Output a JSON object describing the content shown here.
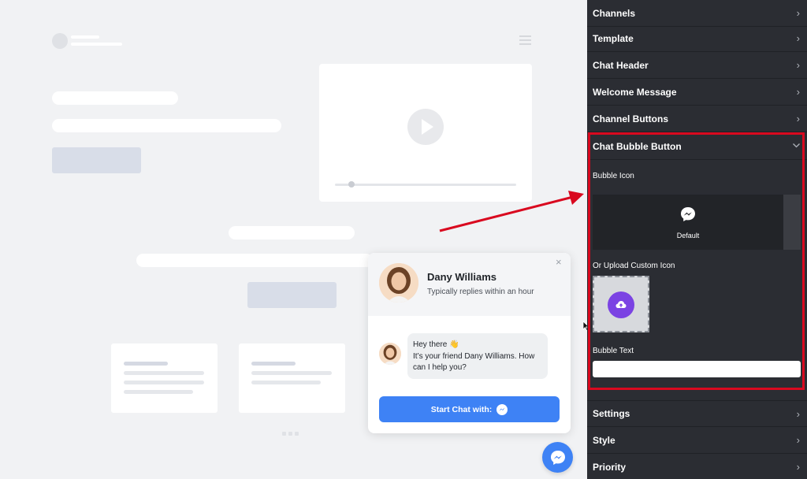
{
  "widget": {
    "name": "Dany Williams",
    "subtitle": "Typically replies within an hour",
    "close": "×",
    "message_line1": "Hey there 👋",
    "message_line2": "It’s your friend Dany Williams. How can I help you?",
    "start_label": "Start Chat with:"
  },
  "panel": {
    "rows_top": [
      "Channels",
      "Template",
      "Chat Header",
      "Welcome Message",
      "Channel Buttons"
    ],
    "section_title": "Chat Bubble Button",
    "bubble_icon_label": "Bubble Icon",
    "default_label": "Default",
    "upload_label": "Or Upload Custom Icon",
    "bubble_text_label": "Bubble Text",
    "bubble_text_value": "",
    "rows_bottom": [
      "Settings",
      "Style",
      "Priority"
    ]
  },
  "colors": {
    "accent": "#3e82f5",
    "highlight": "#d9091f",
    "panel_bg": "#2b2d33",
    "upload": "#7b43e3"
  },
  "icons": [
    "messenger-icon",
    "chevron-right-icon",
    "chevron-down-icon",
    "upload-cloud-icon",
    "close-icon",
    "play-icon",
    "hamburger-icon"
  ]
}
